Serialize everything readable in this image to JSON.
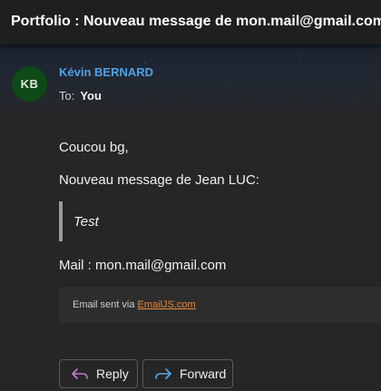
{
  "message": {
    "subject": "Portfolio : Nouveau message de mon.mail@gmail.com",
    "sender": {
      "initials": "KB",
      "name": "Kévin BERNARD",
      "avatar_color": "#0e4a17",
      "name_color": "#4ea3e8"
    },
    "to": {
      "label": "To:",
      "value": "You"
    },
    "body": {
      "greeting": "Coucou bg,",
      "intro": "Nouveau message de Jean LUC:",
      "quote": "Test",
      "mail_line": "Mail : mon.mail@gmail.com"
    },
    "footer": {
      "prefix": "Email sent via ",
      "link_text": "EmailJS.com",
      "link_color": "#e8893a"
    }
  },
  "actions": {
    "reply": {
      "label": "Reply",
      "icon": "reply-icon",
      "icon_color": "#c77dd6"
    },
    "forward": {
      "label": "Forward",
      "icon": "forward-icon",
      "icon_color": "#5aa7e6"
    }
  }
}
